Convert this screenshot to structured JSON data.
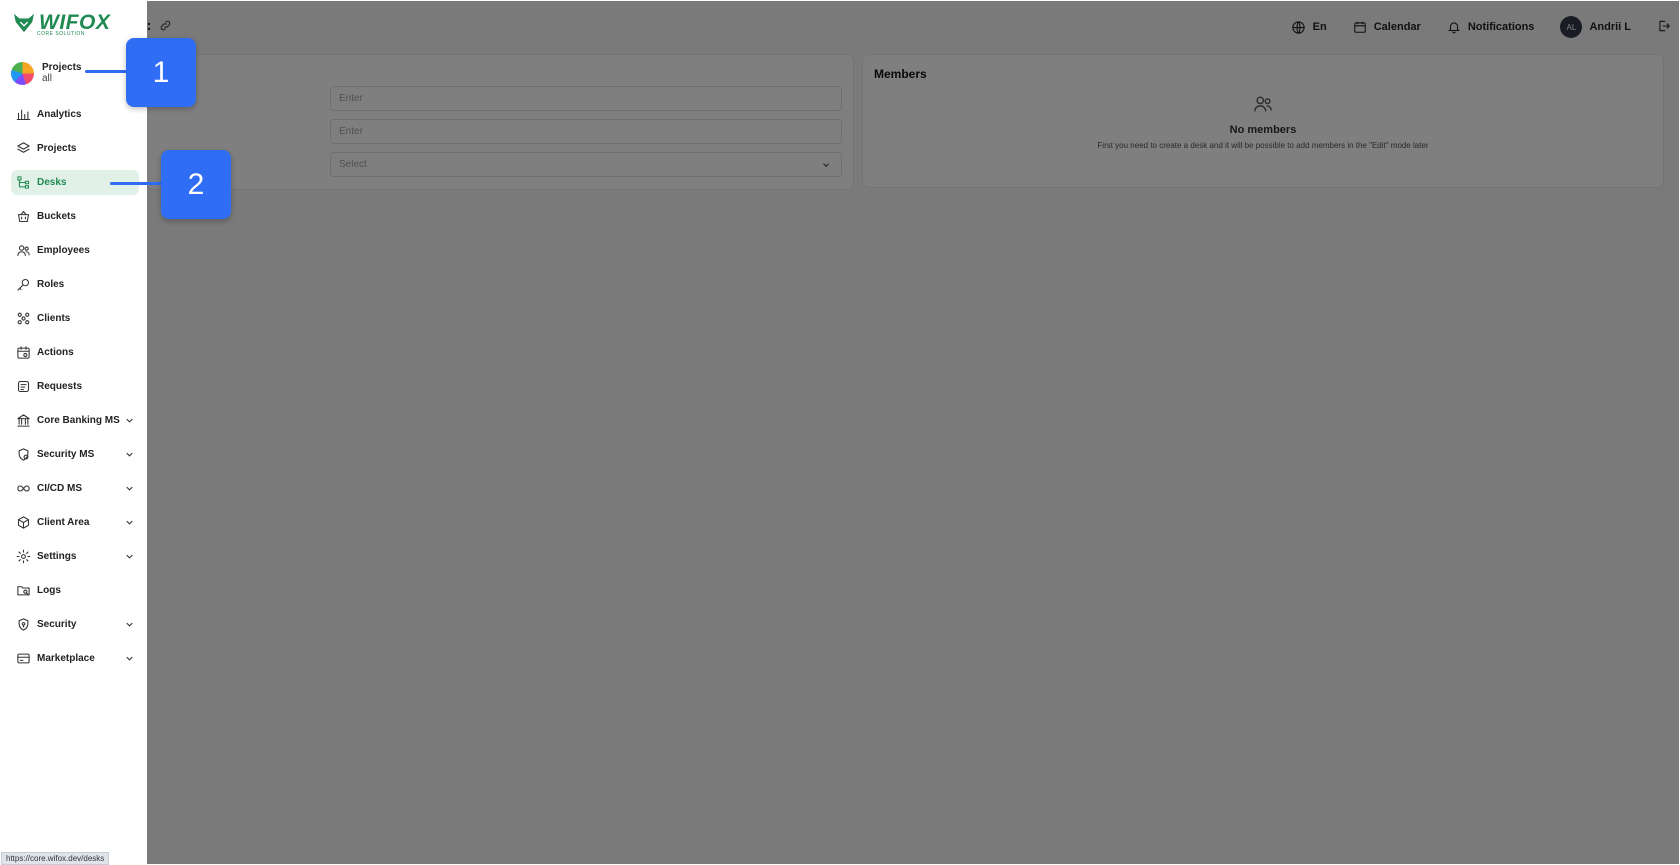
{
  "sidebar": {
    "logo": {
      "title": "WIFOX",
      "subtitle": "CORE SOLUTION"
    },
    "project_selector": {
      "label": "Projects",
      "value": "all"
    },
    "items": [
      {
        "label": "Analytics",
        "icon": "bar-chart-icon",
        "active": false,
        "expandable": false
      },
      {
        "label": "Projects",
        "icon": "layers-icon",
        "active": false,
        "expandable": false
      },
      {
        "label": "Desks",
        "icon": "hierarchy-icon",
        "active": true,
        "expandable": false
      },
      {
        "label": "Buckets",
        "icon": "basket-icon",
        "active": false,
        "expandable": false
      },
      {
        "label": "Employees",
        "icon": "users-icon",
        "active": false,
        "expandable": false
      },
      {
        "label": "Roles",
        "icon": "key-icon",
        "active": false,
        "expandable": false
      },
      {
        "label": "Clients",
        "icon": "clients-icon",
        "active": false,
        "expandable": false
      },
      {
        "label": "Actions",
        "icon": "calendar-action-icon",
        "active": false,
        "expandable": false
      },
      {
        "label": "Requests",
        "icon": "request-icon",
        "active": false,
        "expandable": false
      },
      {
        "label": "Core Banking MS",
        "icon": "bank-icon",
        "active": false,
        "expandable": true
      },
      {
        "label": "Security MS",
        "icon": "security-ms-icon",
        "active": false,
        "expandable": true
      },
      {
        "label": "CI/CD MS",
        "icon": "infinity-icon",
        "active": false,
        "expandable": true
      },
      {
        "label": "Client Area",
        "icon": "cube-icon",
        "active": false,
        "expandable": true
      },
      {
        "label": "Settings",
        "icon": "gear-icon",
        "active": false,
        "expandable": true
      },
      {
        "label": "Logs",
        "icon": "folder-search-icon",
        "active": false,
        "expandable": false
      },
      {
        "label": "Security",
        "icon": "shield-icon",
        "active": false,
        "expandable": true
      },
      {
        "label": "Marketplace",
        "icon": "store-icon",
        "active": false,
        "expandable": true
      }
    ]
  },
  "topbar": {
    "language": "En",
    "calendar": "Calendar",
    "notifications": "Notifications",
    "user_initials": "AL",
    "user_name": "Andrii L"
  },
  "form": {
    "field1_placeholder": "Enter",
    "field2_placeholder": "Enter",
    "select_placeholder": "Select"
  },
  "members": {
    "title": "Members",
    "empty_title": "No members",
    "empty_text": "First you need to create a desk and it will be possible to add members in the \"Edit\" mode later"
  },
  "status_url": "https://core.wifox.dev/desks",
  "callouts": {
    "one": "1",
    "two": "2"
  },
  "colors": {
    "brand": "#1f8a52",
    "active_bg": "#e2f1e8",
    "callout": "#2f6df5",
    "overlay": "rgba(0,0,0,0.5)"
  }
}
